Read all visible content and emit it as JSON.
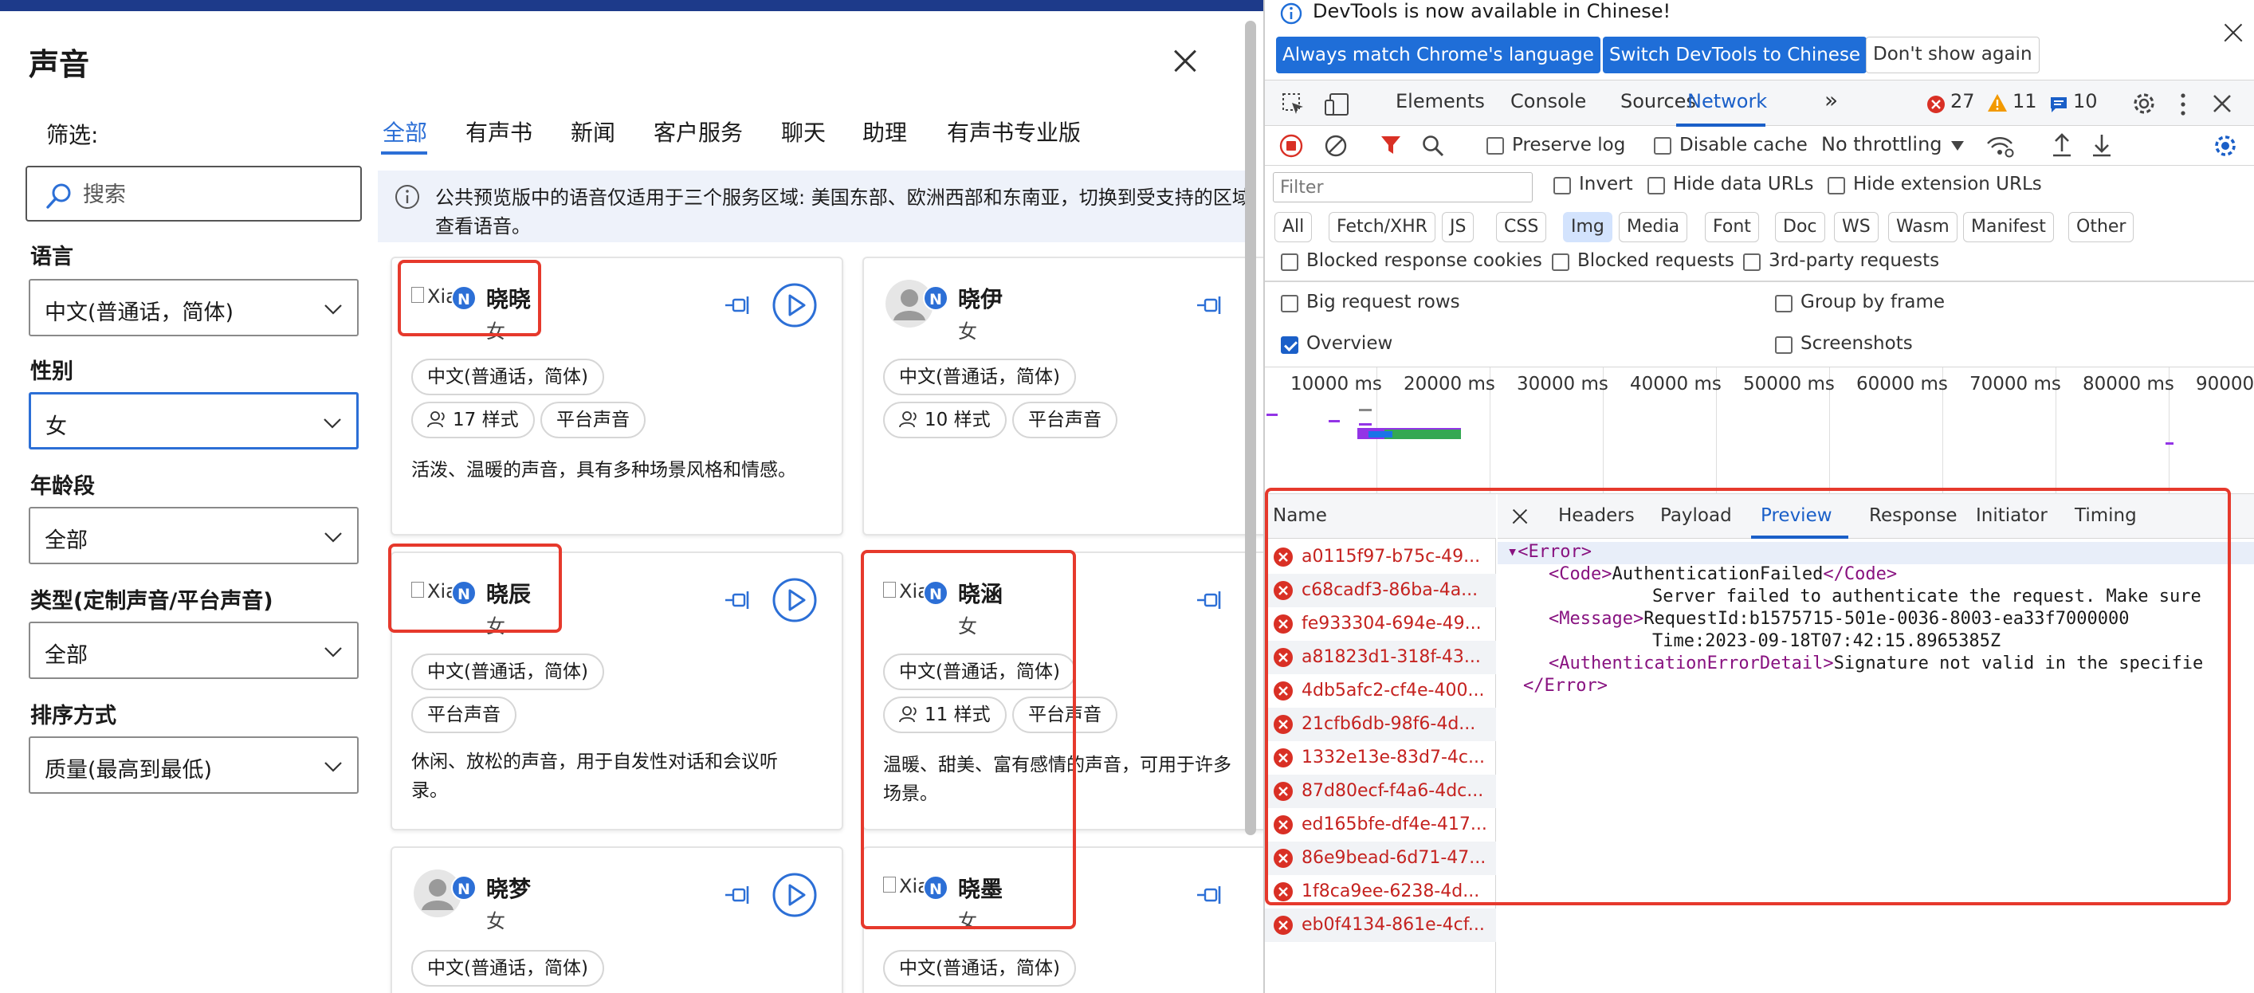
{
  "left_panel": {
    "title": "声音",
    "filter_label": "筛选:",
    "search_placeholder": "搜索",
    "filters": [
      {
        "label": "语言",
        "value": "中文(普通话，简体)"
      },
      {
        "label": "性别",
        "value": "女"
      },
      {
        "label": "年龄段",
        "value": "全部"
      },
      {
        "label": "类型(定制声音/平台声音)",
        "value": "全部"
      },
      {
        "label": "排序方式",
        "value": "质量(最高到最低)"
      }
    ],
    "tabs": [
      "全部",
      "有声书",
      "新闻",
      "客户服务",
      "聊天",
      "助理",
      "有声书专业版"
    ],
    "notice": {
      "line1": "公共预览版中的语音仅适用于三个服务区域: 美国东部、欧洲西部和东南亚，切换到受支持的区域",
      "line2": "查看语音。"
    },
    "cards": [
      {
        "name": "晓晓",
        "gender": "女",
        "badge": "N",
        "avatar_alt": "Xia",
        "chips": [
          "中文(普通话，简体)",
          "17 样式",
          "平台声音"
        ],
        "desc": [
          "活泼、温暖的声音，具有多种场景风格和情感。"
        ]
      },
      {
        "name": "晓伊",
        "gender": "女",
        "badge": "N",
        "chips": [
          "中文(普通话，简体)",
          "10 样式",
          "平台声音"
        ]
      },
      {
        "name": "晓辰",
        "gender": "女",
        "badge": "N",
        "avatar_alt": "Xia",
        "chips": [
          "中文(普通话，简体)",
          "平台声音"
        ],
        "desc": [
          "休闲、放松的声音，用于自发性对话和会议听",
          "录。"
        ]
      },
      {
        "name": "晓涵",
        "gender": "女",
        "badge": "N",
        "avatar_alt": "Xia",
        "chips": [
          "中文(普通话，简体)",
          "11 样式",
          "平台声音"
        ],
        "desc": [
          "温暖、甜美、富有感情的声音，可用于许多",
          "场景。"
        ]
      },
      {
        "name": "晓梦",
        "gender": "女",
        "badge": "N",
        "chips": [
          "中文(普通话，简体)"
        ]
      },
      {
        "name": "晓墨",
        "gender": "女",
        "badge": "N",
        "avatar_alt": "Xia",
        "chips": [
          "中文(普通话，简体)"
        ]
      }
    ],
    "colors": {
      "accent": "#2c6fd6",
      "highlight": "#e6392c"
    }
  },
  "devtools": {
    "infobar": {
      "text": "DevTools is now available in Chinese!",
      "btn_match": "Always match Chrome's language",
      "btn_switch": "Switch DevTools to Chinese",
      "btn_dismiss": "Don't show again"
    },
    "tabs": [
      "Elements",
      "Console",
      "Sources",
      "Network"
    ],
    "counts": {
      "errors": "27",
      "warnings": "11",
      "messages": "10"
    },
    "network_bar": {
      "preserve_log": "Preserve log",
      "disable_cache": "Disable cache",
      "throttling": "No throttling"
    },
    "filter": {
      "placeholder": "Filter",
      "invert": "Invert",
      "hide_data": "Hide data URLs",
      "hide_ext": "Hide extension URLs",
      "types": [
        "All",
        "Fetch/XHR",
        "JS",
        "CSS",
        "Img",
        "Media",
        "Font",
        "Doc",
        "WS",
        "Wasm",
        "Manifest",
        "Other"
      ],
      "blocked_cookies": "Blocked response cookies",
      "blocked_requests": "Blocked requests",
      "third_party": "3rd-party requests",
      "big_rows": "Big request rows",
      "group_frame": "Group by frame",
      "overview": "Overview",
      "screenshots": "Screenshots"
    },
    "timeline_labels": [
      "10000 ms",
      "20000 ms",
      "30000 ms",
      "40000 ms",
      "50000 ms",
      "60000 ms",
      "70000 ms",
      "80000 ms",
      "90000"
    ],
    "requests_header": "Name",
    "requests": [
      "a0115f97-b75c-49...",
      "c68cadf3-86ba-4a...",
      "fe933304-694e-49...",
      "a81823d1-318f-43...",
      "4db5afc2-cf4e-400...",
      "21cfb6db-98f6-4d...",
      "1332e13e-83d7-4c...",
      "87d80ecf-f4a6-4dc...",
      "ed165bfe-df4e-417...",
      "86e9bead-6d71-47...",
      "1f8ca9ee-6238-4d...",
      "eb0f4134-861e-4cf..."
    ],
    "detail_tabs": [
      "Headers",
      "Payload",
      "Preview",
      "Response",
      "Initiator",
      "Timing"
    ],
    "xml": {
      "l1": "▾<Error>",
      "l2_open": "<Code>",
      "l2_text": "AuthenticationFailed",
      "l2_close": "</Code>",
      "l3": "Server failed to authenticate the request. Make sure",
      "l4_open": "<Message>",
      "l4_text": "RequestId:b1575715-501e-0036-8003-ea33f7000000",
      "l5": "Time:2023-09-18T07:42:15.8965385Z",
      "l6_open": "<AuthenticationErrorDetail>",
      "l6_text": "Signature not valid in the specifie",
      "l7": "</Error>"
    }
  }
}
